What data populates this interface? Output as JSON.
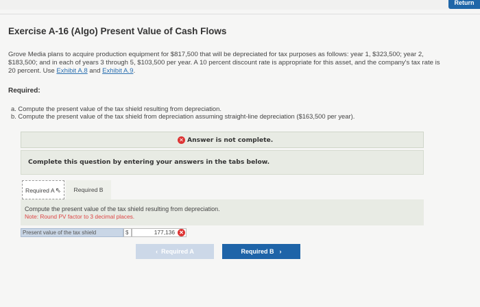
{
  "header": {
    "return_label": "Return"
  },
  "exercise": {
    "title": "Exercise A-16 (Algo) Present Value of Cash Flows",
    "para_text": "Grove Media plans to acquire production equipment for $817,500 that will be depreciated for tax purposes as follows: year 1, $323,500; year 2, $183,500; and in each of years 3 through 5, $103,500 per year. A 10 percent discount rate is appropriate for this asset, and the company's tax rate is 20 percent. Use ",
    "link1": "Exhibit A.8",
    "and": " and ",
    "link2": "Exhibit A.9",
    "period": ".",
    "required_label": "Required:",
    "req_a": "a. Compute the present value of the tax shield resulting from depreciation.",
    "req_b": "b. Compute the present value of the tax shield from depreciation assuming straight-line depreciation ($163,500 per year)."
  },
  "status": {
    "banner": "Answer is not complete."
  },
  "instruction": "Complete this question by entering your answers in the tabs below.",
  "tabs": [
    {
      "label": "Required A"
    },
    {
      "label": "Required B"
    }
  ],
  "tab_content": {
    "prompt": "Compute the present value of the tax shield resulting from depreciation.",
    "note": "Note: Round PV factor to 3 decimal places."
  },
  "answer_row": {
    "label": "Present value of the tax shield",
    "currency": "$",
    "value": "177,136"
  },
  "nav": {
    "prev_label": "Required A",
    "next_label": "Required B"
  }
}
